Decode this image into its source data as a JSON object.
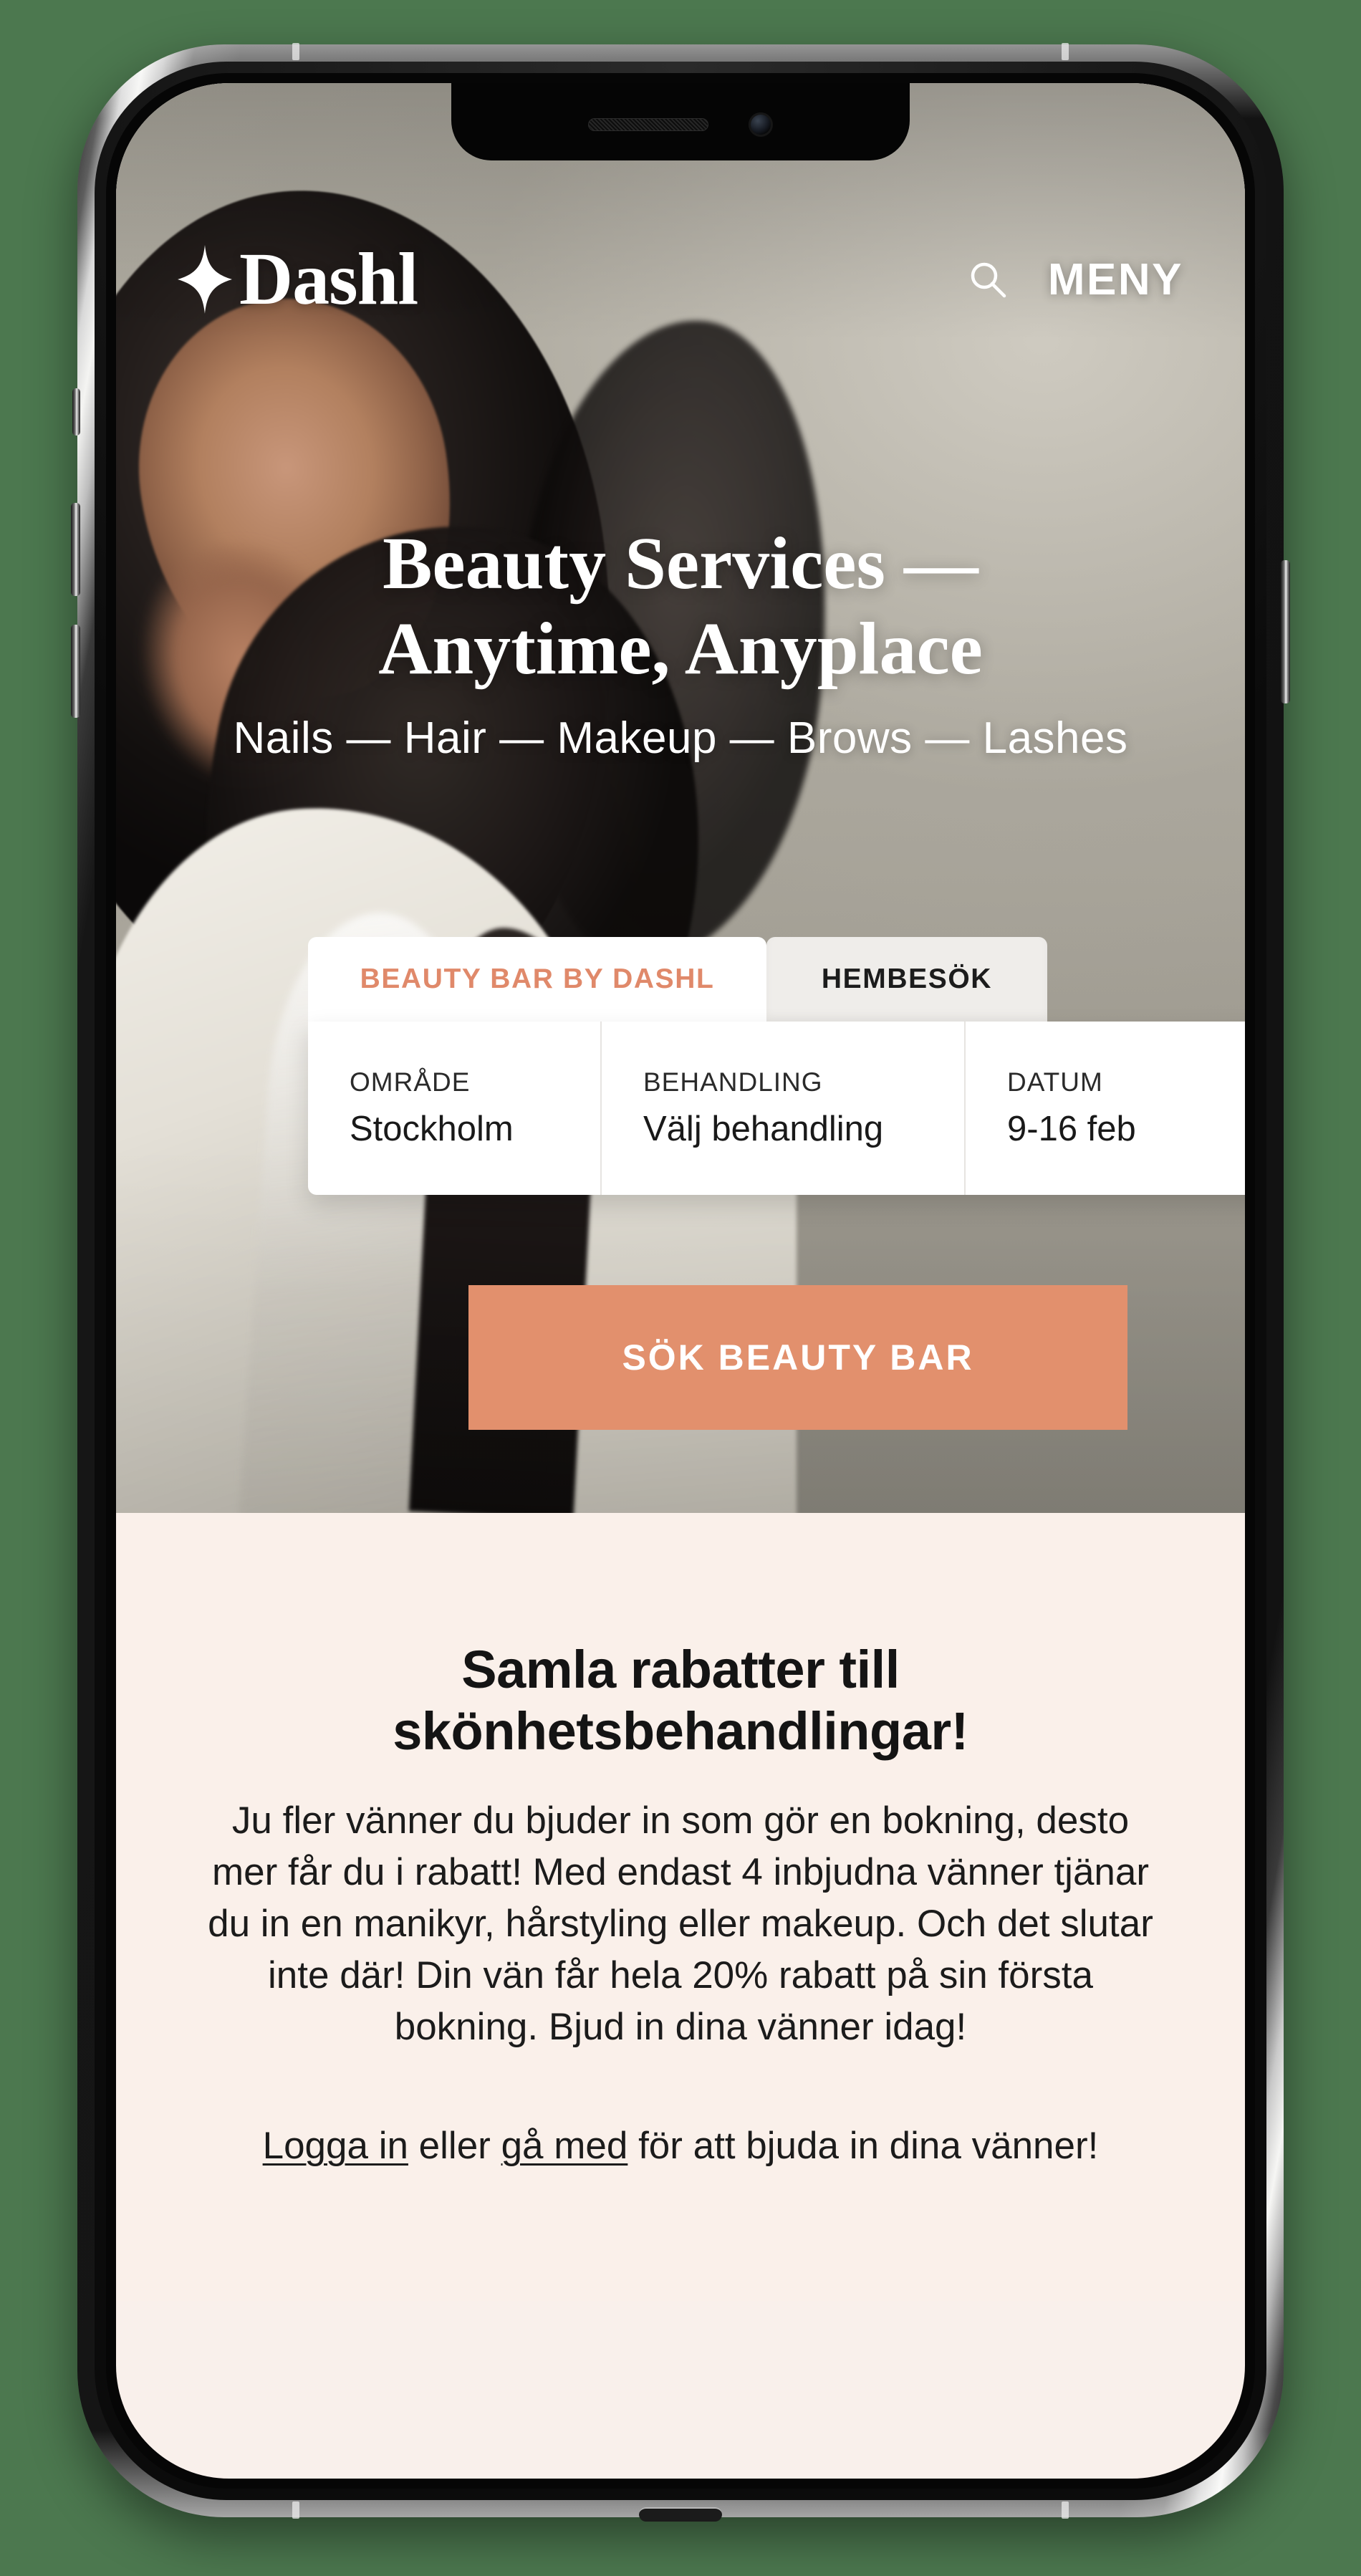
{
  "device": {
    "kind": "smartphone-mockup",
    "notch": {
      "speaker": "speaker-grille",
      "camera": "front-camera"
    }
  },
  "background_color": "#4c784f",
  "colors": {
    "accent": "#e2906d",
    "promo_bg": "#faf0ea",
    "tab_active_bg": "#ffffff",
    "tab_inactive_bg": "#efedea",
    "text_dark": "#141414"
  },
  "header": {
    "logo_text": "Dashl",
    "logo_icon": "sparkle-star-icon",
    "search_icon": "search-icon",
    "menu_label": "MENY"
  },
  "hero": {
    "title_line1": "Beauty Services —",
    "title_line2": "Anytime, Anyplace",
    "subtitle": "Nails — Hair — Makeup — Brows — Lashes"
  },
  "booking": {
    "tabs": [
      {
        "label": "BEAUTY BAR BY DASHL",
        "active": true
      },
      {
        "label": "HEMBESÖK",
        "active": false
      }
    ],
    "fields": [
      {
        "label": "OMRÅDE",
        "value": "Stockholm"
      },
      {
        "label": "BEHANDLING",
        "value": "Välj behandling"
      },
      {
        "label": "DATUM",
        "value": "9-16 feb"
      }
    ],
    "submit_label": "SÖK BEAUTY BAR"
  },
  "promo": {
    "title_line1": "Samla rabatter till",
    "title_line2": "skönhetsbehandlingar!",
    "body": "Ju fler vänner du bjuder in som gör en bokning, desto mer får du i rabatt! Med endast 4 inbjudna vänner tjänar du in en manikyr, hårstyling eller makeup. Och det slutar inte där! Din vän får hela 20% rabatt på sin första bokning. Bjud in dina vänner idag!",
    "link_login": "Logga in",
    "link_middle": " eller ",
    "link_join": "gå med",
    "link_tail": " för att bjuda in dina vänner!"
  }
}
